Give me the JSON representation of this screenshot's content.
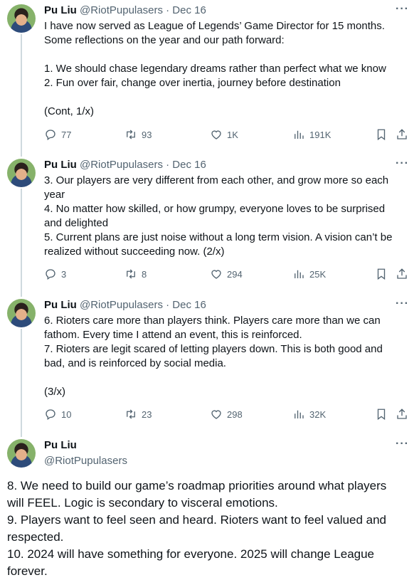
{
  "tweets": [
    {
      "name": "Pu Liu",
      "handle": "@RiotPupulasers",
      "sep": "·",
      "date": "Dec 16",
      "lines": [
        "I have now served as League of Legends’ Game Director for 15 months.",
        "Some reflections on the year and our path forward:",
        "",
        "1. We should chase legendary dreams rather than perfect what we know",
        "2. Fun over fair, change over inertia, journey before destination",
        "",
        "(Cont, 1/x)"
      ],
      "replies": "77",
      "reposts": "93",
      "likes": "1K",
      "views": "191K"
    },
    {
      "name": "Pu Liu",
      "handle": "@RiotPupulasers",
      "sep": "·",
      "date": "Dec 16",
      "lines": [
        "3. Our players are very different from each other, and grow more so each",
        "year",
        "4. No matter how skilled, or how grumpy, everyone loves to be surprised",
        "and delighted",
        "5. Current plans are just noise without a long term vision. A vision can’t be",
        "realized without succeeding now. (2/x)"
      ],
      "replies": "3",
      "reposts": "8",
      "likes": "294",
      "views": "25K"
    },
    {
      "name": "Pu Liu",
      "handle": "@RiotPupulasers",
      "sep": "·",
      "date": "Dec 16",
      "lines": [
        "6. Rioters care more than players think. Players care more than we can",
        "fathom. Every time I attend an event, this is reinforced.",
        "7. Rioters are legit scared of letting players down. This is both good and",
        "bad, and is reinforced by social media.",
        "",
        "(3/x)"
      ],
      "replies": "10",
      "reposts": "23",
      "likes": "298",
      "views": "32K"
    }
  ],
  "main_tweet": {
    "name": "Pu Liu",
    "handle": "@RiotPupulasers",
    "lines": [
      "8. We need to build our game’s roadmap priorities around what players",
      "will FEEL. Logic is secondary to visceral emotions.",
      "9. Players want to feel seen and heard. Rioters want to feel valued and",
      "respected.",
      "10. 2024 will have something for everyone. 2025 will change League",
      "forever."
    ]
  },
  "more_label": "···",
  "icons": {
    "reply": "reply-icon",
    "repost": "repost-icon",
    "like": "heart-icon",
    "views": "views-icon",
    "bookmark": "bookmark-icon",
    "share": "share-icon"
  }
}
